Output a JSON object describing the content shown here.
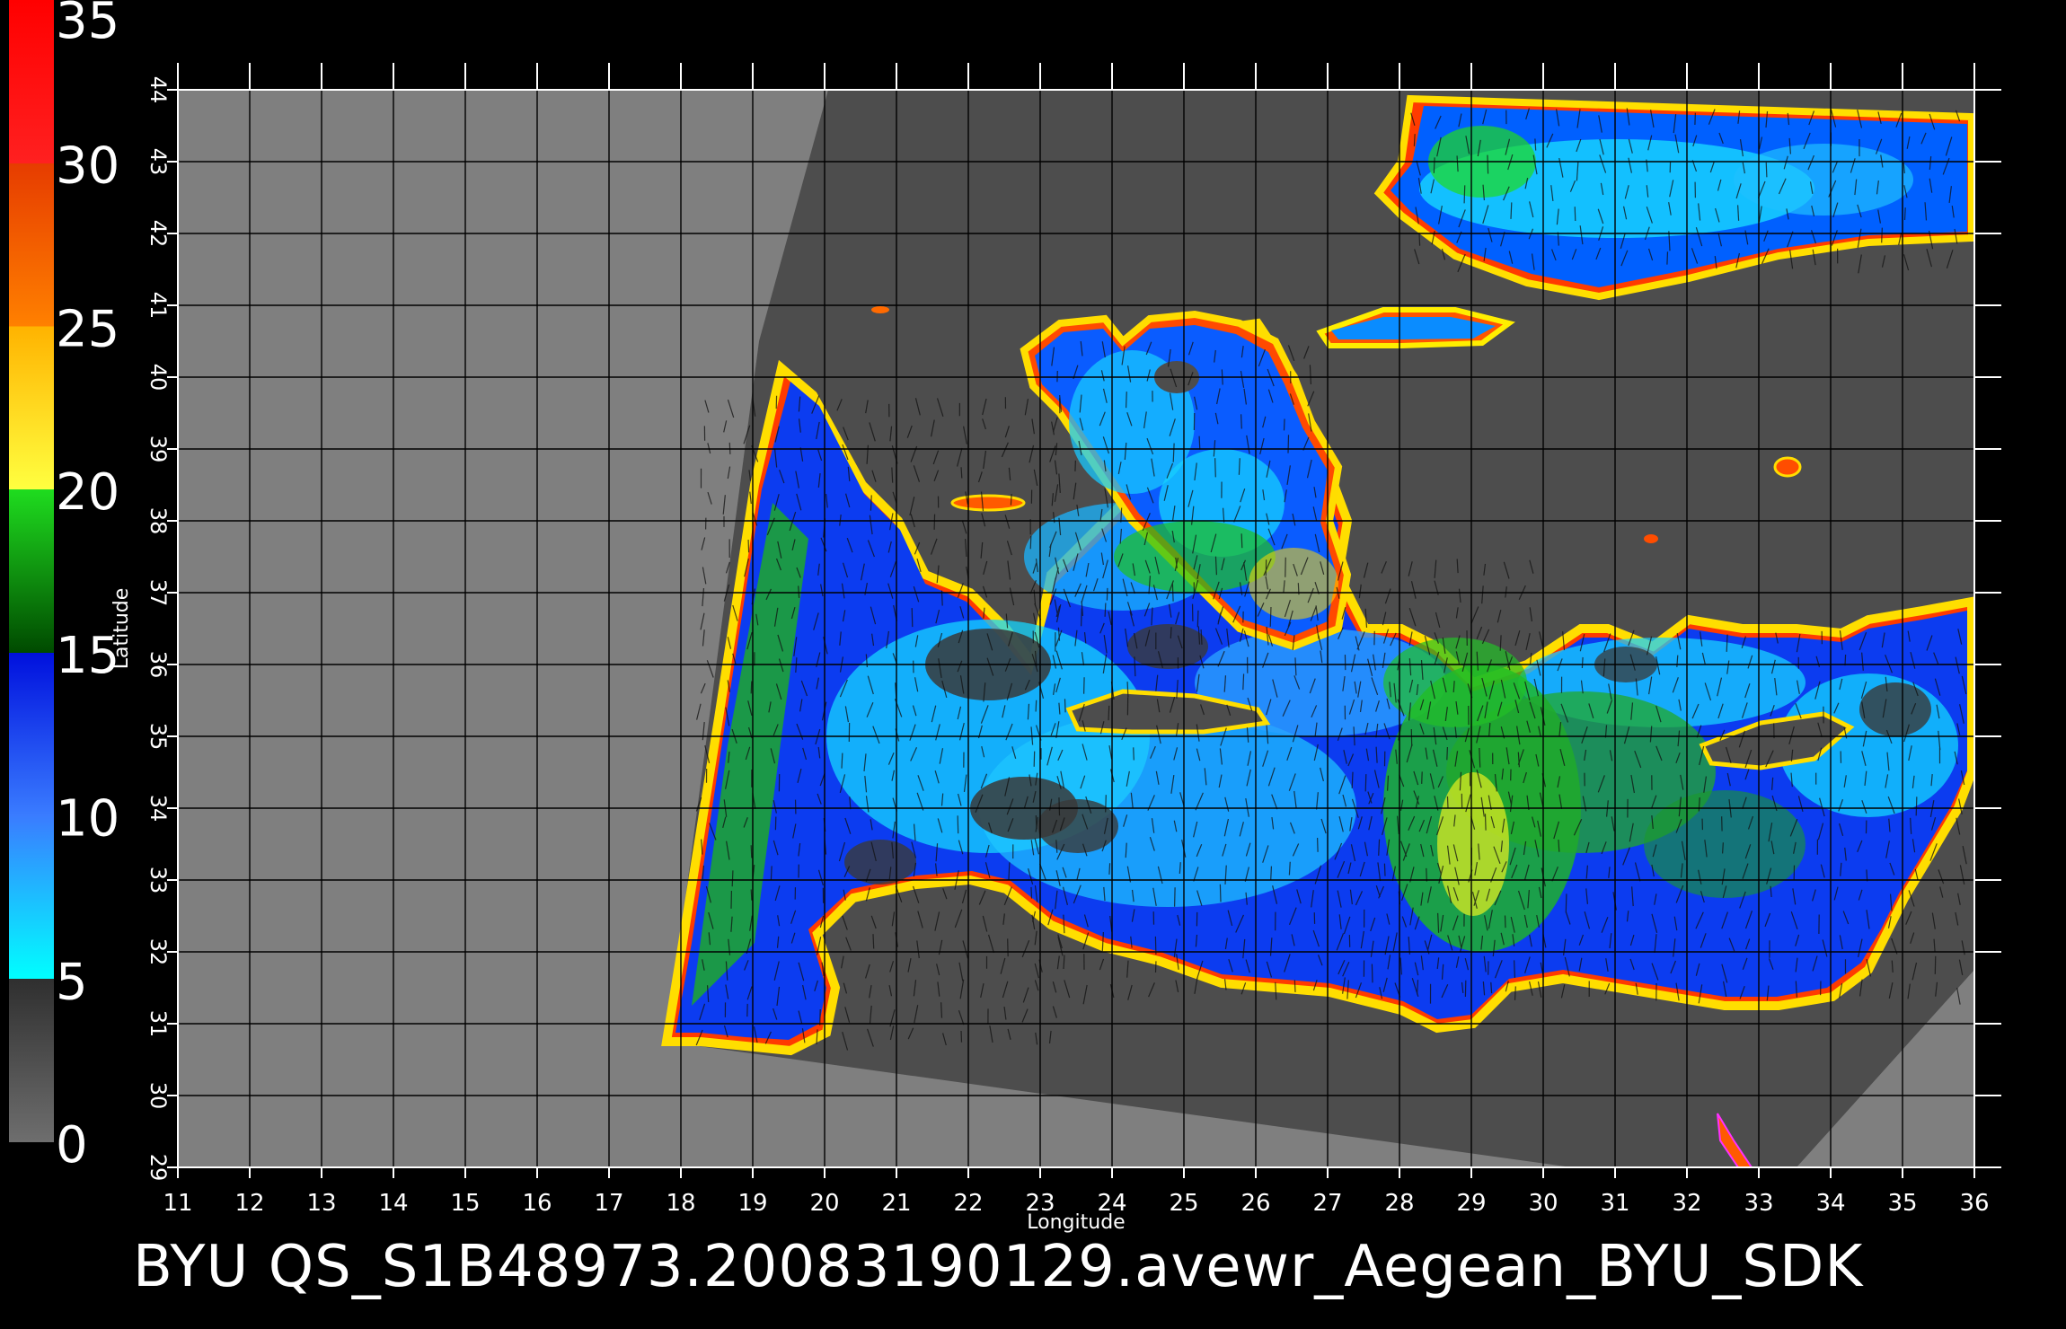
{
  "colorbar": {
    "labels": [
      "0",
      "5",
      "10",
      "15",
      "20",
      "25",
      "30",
      "35"
    ],
    "stops": [
      {
        "value": 0,
        "color": "#6e6e6e"
      },
      {
        "value": 5,
        "color": "#2f2f2f"
      },
      {
        "value": 5,
        "color": "#00ffff"
      },
      {
        "value": 10,
        "color": "#3a7cff"
      },
      {
        "value": 15,
        "color": "#0010dd"
      },
      {
        "value": 15,
        "color": "#004a00"
      },
      {
        "value": 20,
        "color": "#1fdc1f"
      },
      {
        "value": 20,
        "color": "#ffff40"
      },
      {
        "value": 25,
        "color": "#ffb300"
      },
      {
        "value": 25,
        "color": "#ff8000"
      },
      {
        "value": 30,
        "color": "#e63c00"
      },
      {
        "value": 30,
        "color": "#ff2020"
      },
      {
        "value": 35,
        "color": "#ff0000"
      },
      {
        "value": 35,
        "color": "#c8865c"
      }
    ]
  },
  "map": {
    "xlabel": "Longitude",
    "ylabel": "Latitude",
    "xticks": [
      "11",
      "12",
      "13",
      "14",
      "15",
      "16",
      "17",
      "18",
      "19",
      "20",
      "21",
      "22",
      "23",
      "24",
      "25",
      "26",
      "27",
      "28",
      "29",
      "30",
      "31",
      "32",
      "33",
      "34",
      "35",
      "36"
    ],
    "yticks": [
      "29",
      "30",
      "31",
      "32",
      "33",
      "34",
      "35",
      "36",
      "37",
      "38",
      "39",
      "40",
      "41",
      "42",
      "43",
      "44"
    ],
    "lon_range": [
      11,
      36
    ],
    "lat_range": [
      29,
      44
    ],
    "colors": {
      "background": "#000000",
      "no_data": "#7f7f7f",
      "land": "#4d4d4d",
      "grid": "#000000",
      "axis": "#ffffff"
    }
  },
  "caption": "BYU  QS_S1B48973.20083190129.avewr_Aegean_BYU_SDK"
}
